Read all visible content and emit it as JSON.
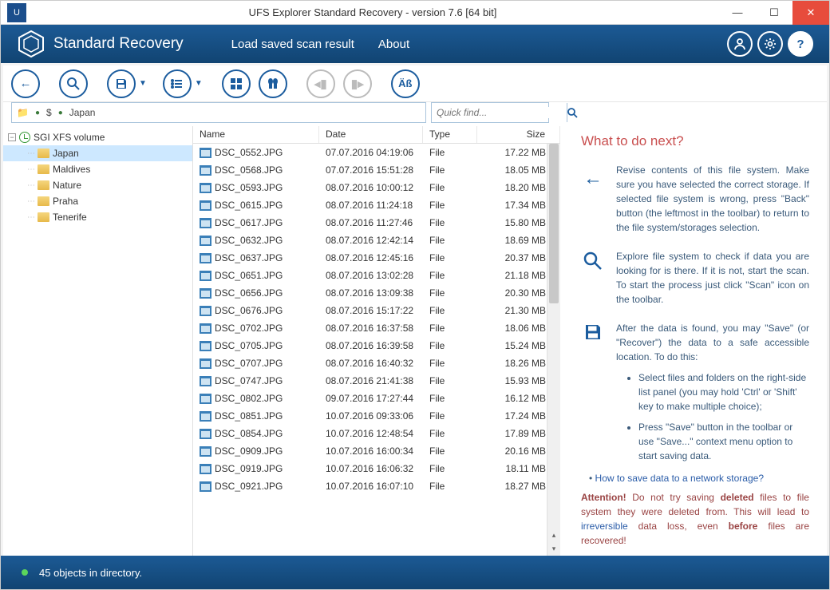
{
  "title": "UFS Explorer Standard Recovery - version 7.6 [64 bit]",
  "product_name": "Standard Recovery",
  "menu": {
    "load": "Load saved scan result",
    "about": "About"
  },
  "path": {
    "segment": "$",
    "folder": "Japan"
  },
  "search": {
    "placeholder": "Quick find..."
  },
  "tree": {
    "root": "SGI XFS volume",
    "folders": [
      "Japan",
      "Maldives",
      "Nature",
      "Praha",
      "Tenerife"
    ]
  },
  "columns": {
    "name": "Name",
    "date": "Date",
    "type": "Type",
    "size": "Size"
  },
  "files": [
    {
      "n": "DSC_0552.JPG",
      "d": "07.07.2016 04:19:06",
      "t": "File",
      "s": "17.22 MB"
    },
    {
      "n": "DSC_0568.JPG",
      "d": "07.07.2016 15:51:28",
      "t": "File",
      "s": "18.05 MB"
    },
    {
      "n": "DSC_0593.JPG",
      "d": "08.07.2016 10:00:12",
      "t": "File",
      "s": "18.20 MB"
    },
    {
      "n": "DSC_0615.JPG",
      "d": "08.07.2016 11:24:18",
      "t": "File",
      "s": "17.34 MB"
    },
    {
      "n": "DSC_0617.JPG",
      "d": "08.07.2016 11:27:46",
      "t": "File",
      "s": "15.80 MB"
    },
    {
      "n": "DSC_0632.JPG",
      "d": "08.07.2016 12:42:14",
      "t": "File",
      "s": "18.69 MB"
    },
    {
      "n": "DSC_0637.JPG",
      "d": "08.07.2016 12:45:16",
      "t": "File",
      "s": "20.37 MB"
    },
    {
      "n": "DSC_0651.JPG",
      "d": "08.07.2016 13:02:28",
      "t": "File",
      "s": "21.18 MB"
    },
    {
      "n": "DSC_0656.JPG",
      "d": "08.07.2016 13:09:38",
      "t": "File",
      "s": "20.30 MB"
    },
    {
      "n": "DSC_0676.JPG",
      "d": "08.07.2016 15:17:22",
      "t": "File",
      "s": "21.30 MB"
    },
    {
      "n": "DSC_0702.JPG",
      "d": "08.07.2016 16:37:58",
      "t": "File",
      "s": "18.06 MB"
    },
    {
      "n": "DSC_0705.JPG",
      "d": "08.07.2016 16:39:58",
      "t": "File",
      "s": "15.24 MB"
    },
    {
      "n": "DSC_0707.JPG",
      "d": "08.07.2016 16:40:32",
      "t": "File",
      "s": "18.26 MB"
    },
    {
      "n": "DSC_0747.JPG",
      "d": "08.07.2016 21:41:38",
      "t": "File",
      "s": "15.93 MB"
    },
    {
      "n": "DSC_0802.JPG",
      "d": "09.07.2016 17:27:44",
      "t": "File",
      "s": "16.12 MB"
    },
    {
      "n": "DSC_0851.JPG",
      "d": "10.07.2016 09:33:06",
      "t": "File",
      "s": "17.24 MB"
    },
    {
      "n": "DSC_0854.JPG",
      "d": "10.07.2016 12:48:54",
      "t": "File",
      "s": "17.89 MB"
    },
    {
      "n": "DSC_0909.JPG",
      "d": "10.07.2016 16:00:34",
      "t": "File",
      "s": "20.16 MB"
    },
    {
      "n": "DSC_0919.JPG",
      "d": "10.07.2016 16:06:32",
      "t": "File",
      "s": "18.11 MB"
    },
    {
      "n": "DSC_0921.JPG",
      "d": "10.07.2016 16:07:10",
      "t": "File",
      "s": "18.27 MB"
    }
  ],
  "side": {
    "heading": "What to do next?",
    "p1": "Revise contents of this file system. Make sure you have selected the correct storage. If selected file system is wrong, press \"Back\" button (the leftmost in the toolbar) to return to the file system/storages selection.",
    "p2": "Explore file system to check if data you are looking for is there. If it is not, start the scan. To start the process just click \"Scan\" icon on the toolbar.",
    "p3": "After the data is found, you may \"Save\" (or \"Recover\") the data to a safe accessible location. To do this:",
    "li1": "Select files and folders on the right-side list panel (you may hold 'Ctrl' or 'Shift' key to make multiple choice);",
    "li2": "Press \"Save\" button in the toolbar or use \"Save...\" context menu option to start saving data.",
    "link": "How to save data to a network storage?",
    "attn_label": "Attention!",
    "attn_1": " Do not try saving ",
    "attn_deleted": "deleted",
    "attn_2": " files to file system they were deleted from. This will lead to ",
    "attn_irr": "irreversible",
    "attn_3": " data loss, even ",
    "attn_before": "before",
    "attn_4": " files are recovered!"
  },
  "status": "45 objects in directory."
}
